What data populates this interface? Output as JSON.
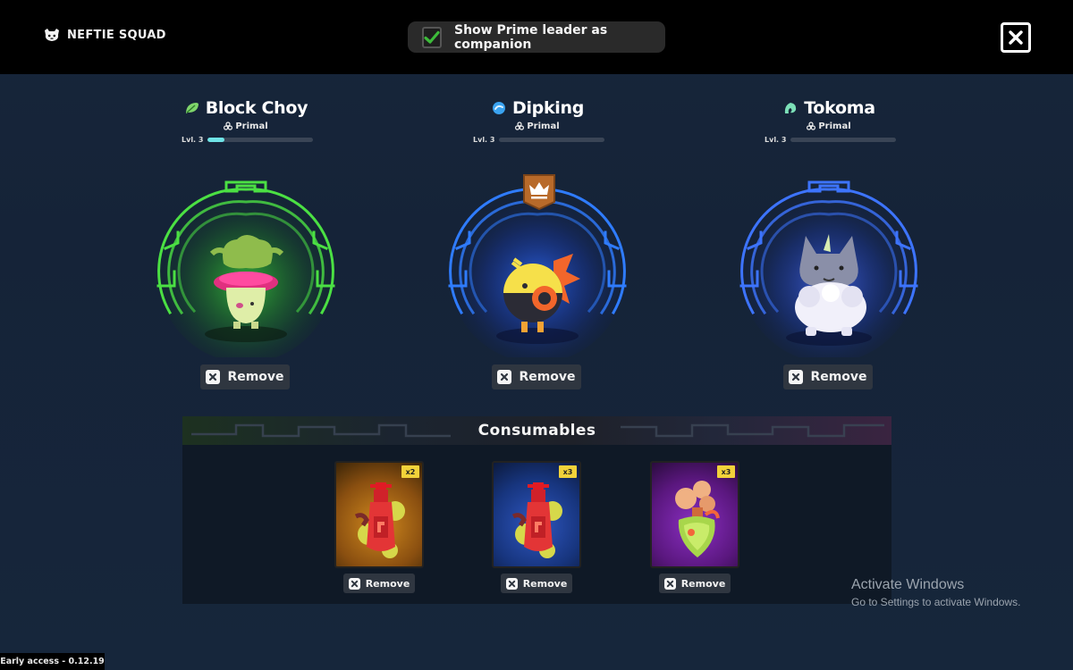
{
  "topbar": {
    "brand_icon": "neftie-face-icon",
    "brand_title": "NEFTIE SQUAD",
    "toggle_label": "Show Prime leader as companion",
    "toggle_checked": true,
    "close_icon": "close-icon",
    "accent_check": "#3dbb3a"
  },
  "companions": [
    {
      "name": "Block Choy",
      "type": "Primal",
      "level_label": "Lvl. 3",
      "level_progress": 0.16,
      "element_icon": "leaf-icon",
      "portal_color": "#3fe03a",
      "is_leader": false,
      "remove_label": "Remove"
    },
    {
      "name": "Dipking",
      "type": "Primal",
      "level_label": "Lvl. 3",
      "level_progress": 0.0,
      "element_icon": "water-icon",
      "portal_color": "#2f6cff",
      "is_leader": true,
      "leader_icon": "crown-icon",
      "remove_label": "Remove"
    },
    {
      "name": "Tokoma",
      "type": "Primal",
      "level_label": "Lvl. 3",
      "level_progress": 0.0,
      "element_icon": "spirit-icon",
      "portal_color": "#3a63ff",
      "is_leader": false,
      "remove_label": "Remove"
    }
  ],
  "consumables": {
    "title": "Consumables",
    "items": [
      {
        "quantity": "x2",
        "icon": "red-potion-icon",
        "background": "#b36a12",
        "remove_label": "Remove"
      },
      {
        "quantity": "x3",
        "icon": "red-potion-icon",
        "background": "#1a3a8a",
        "remove_label": "Remove"
      },
      {
        "quantity": "x3",
        "icon": "green-potion-icon",
        "background": "#6a1ea0",
        "remove_label": "Remove"
      }
    ]
  },
  "watermark": {
    "title": "Activate Windows",
    "subtitle": "Go to Settings to activate Windows."
  },
  "footer": {
    "version": "Early access - 0.12.19"
  }
}
